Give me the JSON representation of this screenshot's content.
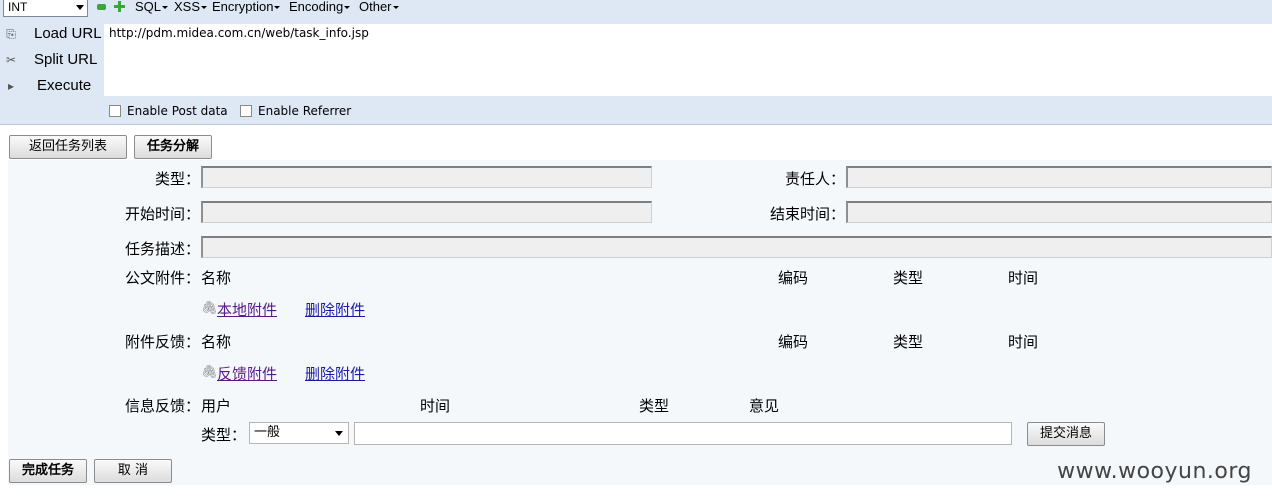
{
  "hackbar": {
    "select_value": "INT",
    "menus": [
      "SQL",
      "XSS",
      "Encryption",
      "Encoding",
      "Other"
    ],
    "load_url": "Load URL",
    "split_url": "Split URL",
    "execute": "Execute",
    "url_value": "http://pdm.midea.com.cn/web/task_info.jsp",
    "enable_post": "Enable Post data",
    "enable_referrer": "Enable Referrer"
  },
  "top_buttons": {
    "back": "返回任务列表",
    "split": "任务分解"
  },
  "form": {
    "type_label": "类型：",
    "owner_label": "责任人：",
    "start_label": "开始时间：",
    "end_label": "结束时间：",
    "desc_label": "任务描述：",
    "doc_attach_label": "公文附件：",
    "feedback_attach_label": "附件反馈：",
    "info_feedback_label": "信息反馈：",
    "attach_columns": [
      "名称",
      "编码",
      "类型",
      "时间"
    ],
    "local_attach": "本地附件",
    "delete_attach": "删除附件",
    "feedback_attach": "反馈附件",
    "info_columns": [
      "用户",
      "时间",
      "类型",
      "意见"
    ],
    "msg_type_label": "类型：",
    "msg_type_value": "一般",
    "submit_msg": "提交消息"
  },
  "bottom_buttons": {
    "complete": "完成任务",
    "cancel": "取 消"
  },
  "watermark": "www.wooyun.org"
}
